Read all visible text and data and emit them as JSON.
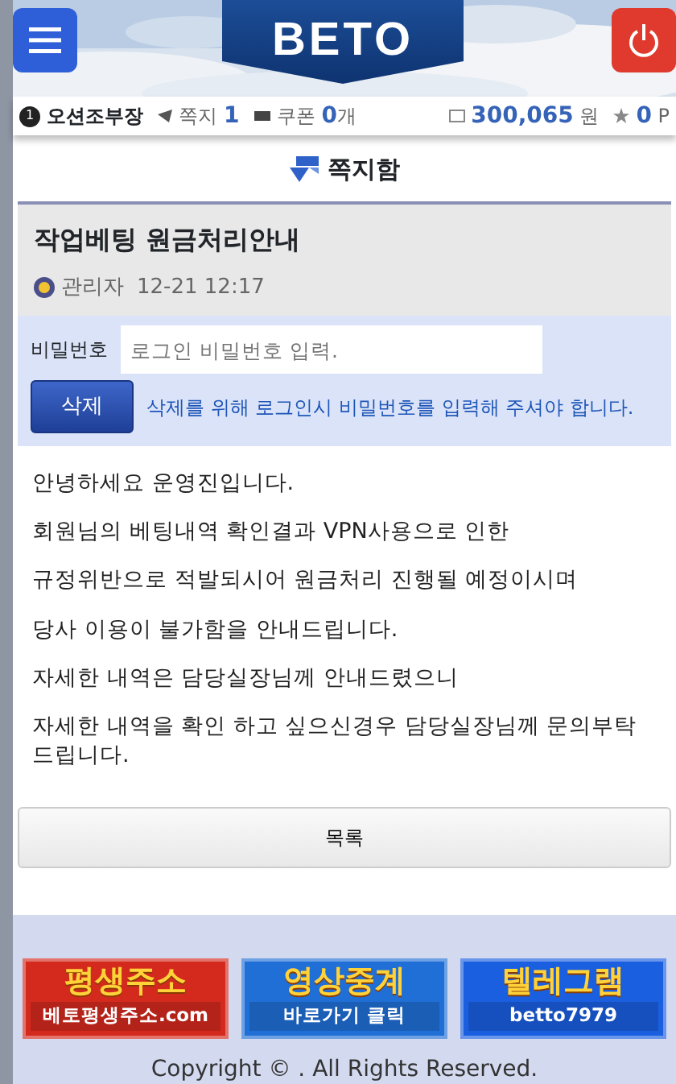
{
  "header": {
    "logo": "BETO"
  },
  "user_bar": {
    "level": "1",
    "username": "오션조부장",
    "memo_label": "쪽지",
    "memo_count": "1",
    "coupon_label": "쿠폰",
    "coupon_count": "0",
    "coupon_unit": "개",
    "balance": "300,065",
    "balance_unit": "원",
    "points": "0",
    "points_unit": "P"
  },
  "page_title": "쪽지함",
  "message": {
    "title": "작업베팅 원금처리안내",
    "author": "관리자",
    "date": "12-21 12:17"
  },
  "delete_form": {
    "label": "비밀번호",
    "placeholder": "로그인 비밀번호 입력.",
    "button": "삭제",
    "note": "삭제를 위해 로그인시 비밀번호를 입력해 주셔야 합니다."
  },
  "body": [
    "안녕하세요 운영진입니다.",
    "회원님의 베팅내역 확인결과 VPN사용으로 인한",
    "규정위반으로 적발되시어 원금처리 진행될 예정이시며",
    "당사 이용이 불가함을 안내드립니다.",
    "자세한 내역은 담당실장님께 안내드렸으니",
    "자세한 내역을 확인 하고 싶으신경우 담당실장님께 문의부탁드립니다."
  ],
  "list_button": "목록",
  "banners": [
    {
      "title": "평생주소",
      "subtitle": "베토평생주소.com",
      "color": "#d42a1e"
    },
    {
      "title": "영상중계",
      "subtitle": "바로가기 클릭",
      "color": "#1f6fd6"
    },
    {
      "title": "텔레그램",
      "subtitle": "betto7979",
      "color": "#1a5fe0"
    }
  ],
  "copyright": "Copyright © . All Rights Reserved."
}
